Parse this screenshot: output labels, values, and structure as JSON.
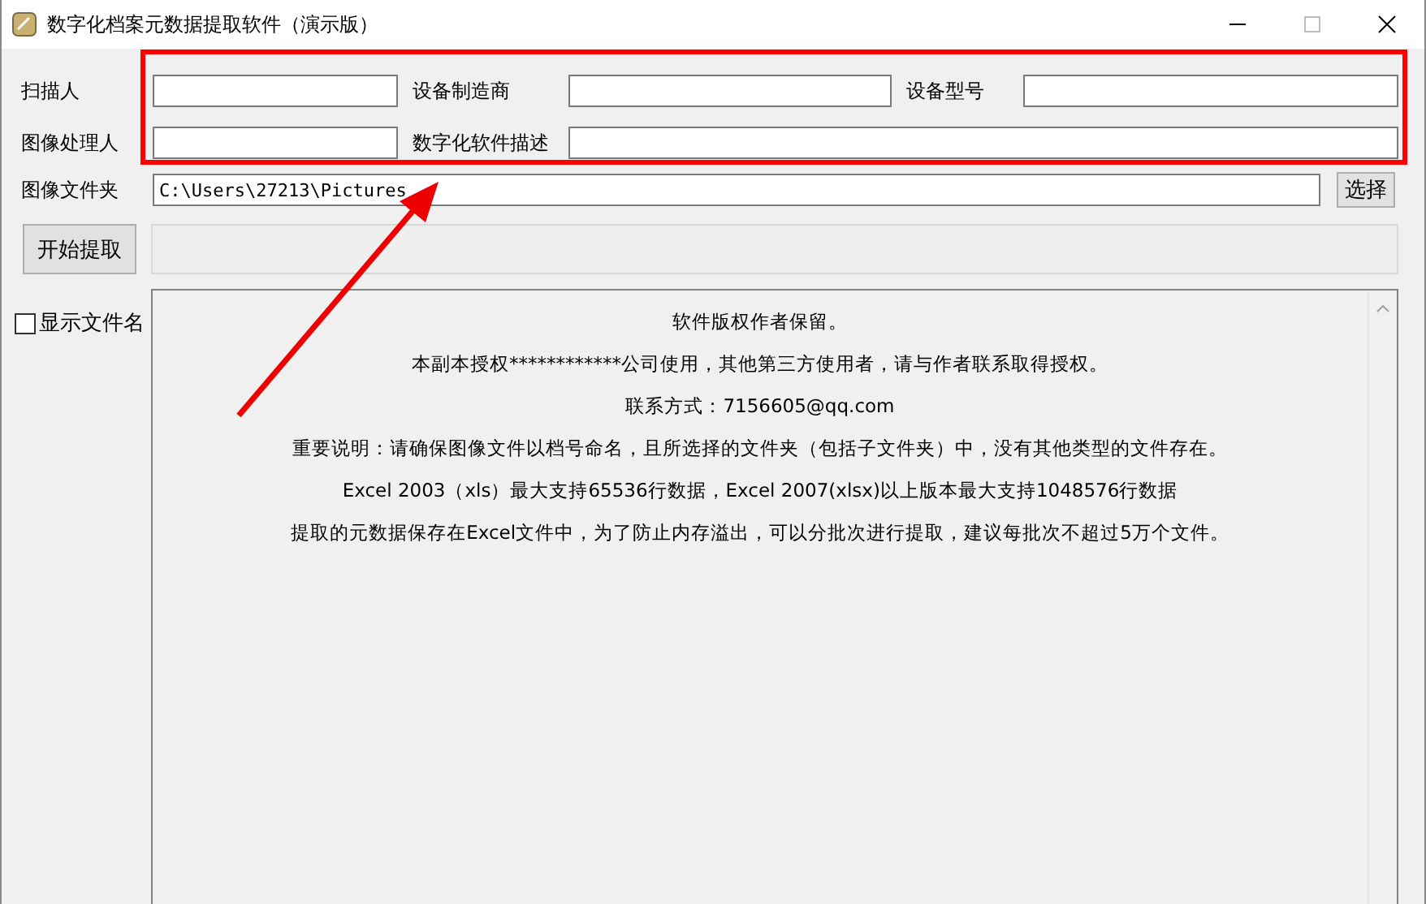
{
  "window": {
    "title": "数字化档案元数据提取软件（演示版）"
  },
  "form_rows": [
    {
      "fields": [
        {
          "label": "扫描人"
        },
        {
          "label": "设备制造商"
        },
        {
          "label": "设备型号"
        }
      ]
    },
    {
      "fields": [
        {
          "label": "图像处理人"
        },
        {
          "label": "数字化软件描述"
        }
      ]
    }
  ],
  "folder": {
    "label": "图像文件夹",
    "value": "C:\\Users\\27213\\Pictures",
    "button": "选择"
  },
  "start_button": "开始提取",
  "show_filenames": {
    "label": "显示文件名",
    "checked": false
  },
  "info_lines": [
    "软件版权作者保留。",
    "本副本授权************公司使用，其他第三方使用者，请与作者联系取得授权。",
    "联系方式：7156605@qq.com",
    "重要说明：请确保图像文件以档号命名，且所选择的文件夹（包括子文件夹）中，没有其他类型的文件存在。",
    "Excel 2003（xls）最大支持65536行数据，Excel 2007(xlsx)以上版本最大支持1048576行数据",
    "提取的元数据保存在Excel文件中，为了防止内存溢出，可以分批次进行提取，建议每批次不超过5万个文件。"
  ]
}
